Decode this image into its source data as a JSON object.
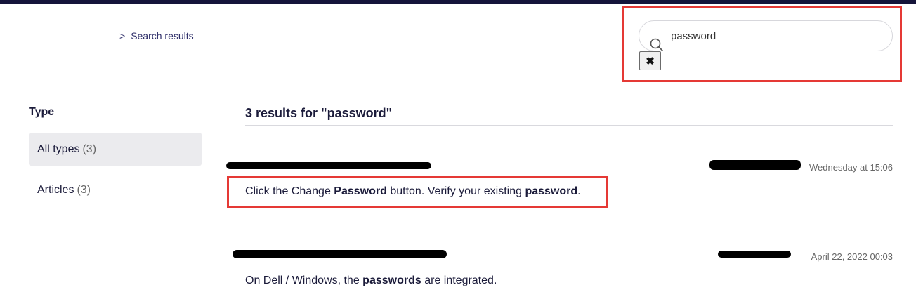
{
  "breadcrumb": {
    "separator": ">",
    "label": "Search results"
  },
  "search": {
    "value": "password",
    "clear_label": "✖"
  },
  "sidebar": {
    "title": "Type",
    "items": [
      {
        "label": "All types",
        "count": "(3)",
        "active": true
      },
      {
        "label": "Articles",
        "count": "(3)",
        "active": false
      }
    ]
  },
  "results": {
    "heading": "3 results for \"password\"",
    "items": [
      {
        "date": "Wednesday at 15:06",
        "snippet": [
          {
            "text": "Click the Change ",
            "bold": false
          },
          {
            "text": "Password",
            "bold": true
          },
          {
            "text": " button. Verify your existing ",
            "bold": false
          },
          {
            "text": "password",
            "bold": true
          },
          {
            "text": ".",
            "bold": false
          }
        ]
      },
      {
        "date": "April 22, 2022 00:03",
        "snippet": [
          {
            "text": "On Dell / Windows, the ",
            "bold": false
          },
          {
            "text": "passwords",
            "bold": true
          },
          {
            "text": " are integrated.",
            "bold": false
          }
        ]
      }
    ]
  },
  "colors": {
    "accent_bar": "#15143a",
    "annotation": "#e53935",
    "text": "#1b1b3a"
  }
}
